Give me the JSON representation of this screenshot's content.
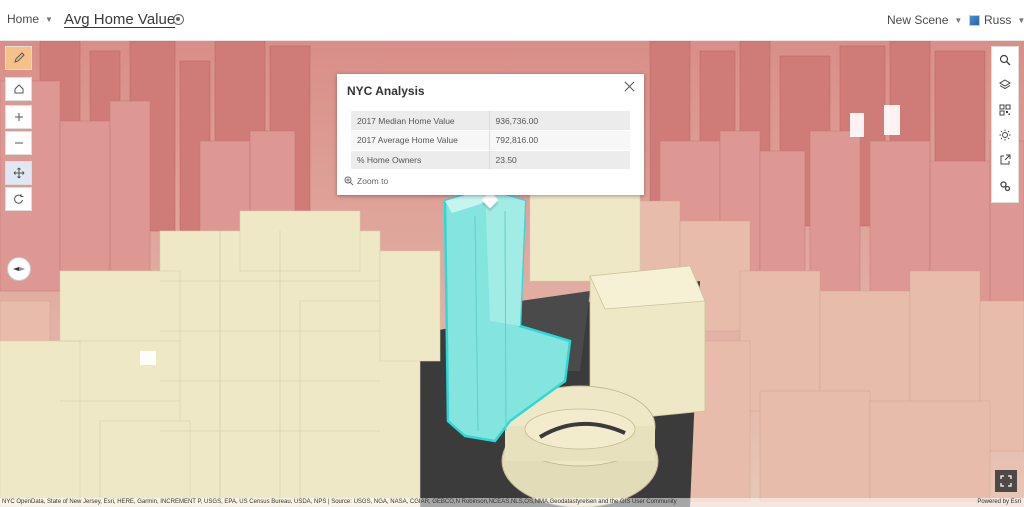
{
  "header": {
    "home_label": "Home",
    "scene_title": "Avg Home Value",
    "new_scene_label": "New Scene",
    "user_name": "Russ"
  },
  "left_toolbar": {
    "tools": [
      "pencil-icon",
      "home-icon",
      "zoom-in-icon",
      "zoom-out-icon",
      "pan-icon",
      "rotate-icon",
      "compass-icon"
    ]
  },
  "right_toolbar": {
    "tools": [
      "search-icon",
      "layers-icon",
      "qr-icon",
      "daylight-icon",
      "share-icon",
      "settings-icon"
    ]
  },
  "popup": {
    "title": "NYC Analysis",
    "rows": [
      {
        "label": "2017 Median Home Value",
        "value": "936,736.00"
      },
      {
        "label": "2017 Average Home Value",
        "value": "792,816.00"
      },
      {
        "label": "% Home Owners",
        "value": "23.50"
      }
    ],
    "zoom_label": "Zoom to"
  },
  "attribution": {
    "text": "NYC OpenData, State of New Jersey, Esri, HERE, Garmin, INCREMENT P, USGS, EPA, US Census Bureau, USDA, NPS | Source: USGS, NGA, NASA, CGIAR, GEBCO,N Robinson,NCEAS,NLS,OS,NMA,Geodatastyrelsen and the GIS User Community",
    "powered_by": "Powered by Esri"
  },
  "colors": {
    "highlight": "#7fe3de",
    "highlight_outline": "#2fd8d8",
    "low_value": "#efe8c6",
    "high_value": "#c96a68"
  }
}
